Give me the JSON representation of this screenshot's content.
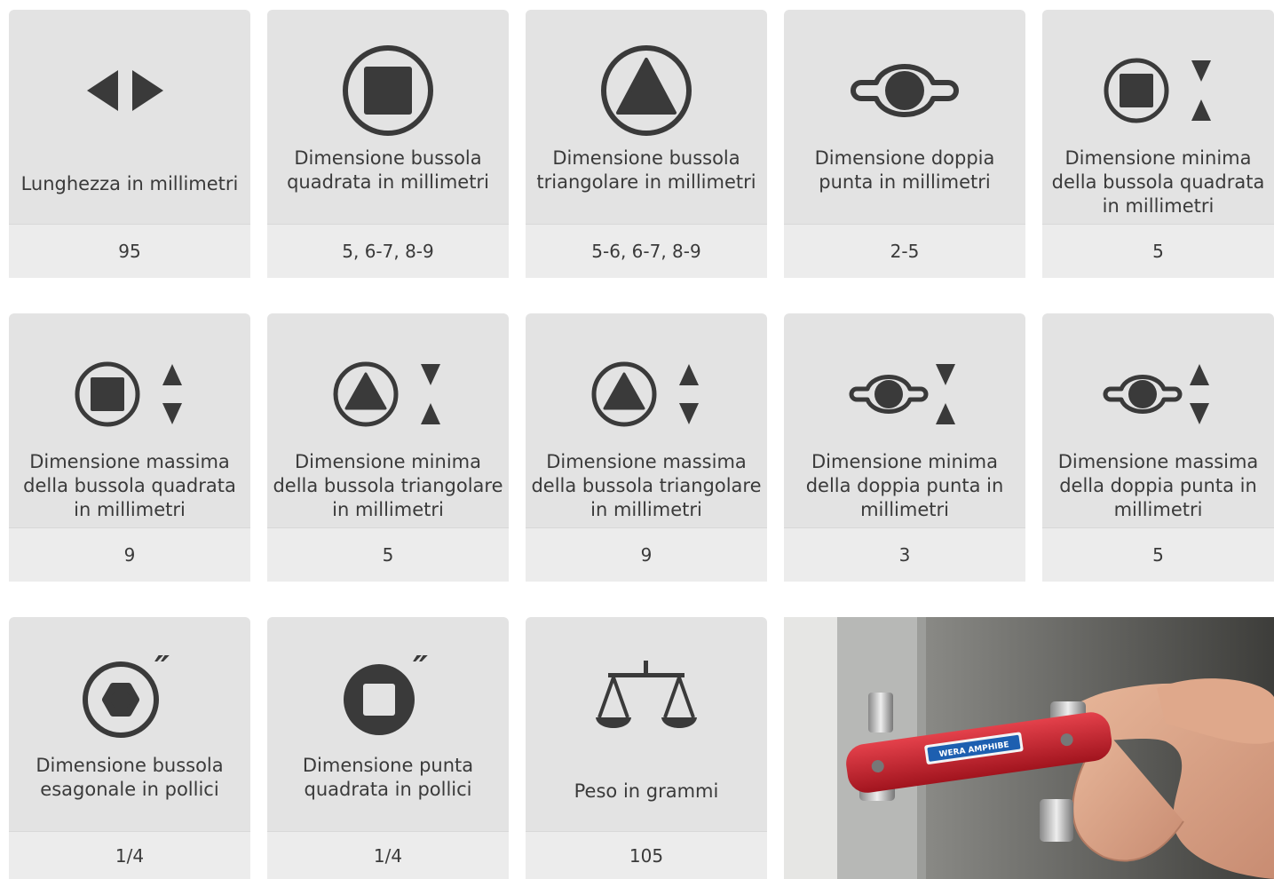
{
  "colors": {
    "card_bg": "#e3e3e3",
    "value_bg": "#ececec",
    "icon": "#3a3a3a",
    "brand_red": "#c8202c"
  },
  "cards": [
    {
      "icon": "arrows-left-right-icon",
      "label": "Lunghezza in millimetri",
      "value": "95"
    },
    {
      "icon": "square-socket-icon",
      "label": "Dimensione bussola\nquadrata in millimetri",
      "value": "5, 6-7, 8-9"
    },
    {
      "icon": "triangle-socket-icon",
      "label": "Dimensione bussola\ntriangolare in millimetri",
      "value": "5-6, 6-7, 8-9"
    },
    {
      "icon": "double-bit-icon",
      "label": "Dimensione doppia\npunta in millimetri",
      "value": "2-5"
    },
    {
      "icon": "square-socket-min-icon",
      "label": "Dimensione minima\ndella bussola quadrata\nin millimetri",
      "value": "5"
    },
    {
      "icon": "square-socket-max-icon",
      "label": "Dimensione massima\ndella bussola quadrata\nin millimetri",
      "value": "9"
    },
    {
      "icon": "triangle-socket-min-icon",
      "label": "Dimensione minima\ndella bussola triangolare\nin millimetri",
      "value": "5"
    },
    {
      "icon": "triangle-socket-max-icon",
      "label": "Dimensione massima\ndella bussola triangolare\nin millimetri",
      "value": "9"
    },
    {
      "icon": "double-bit-min-icon",
      "label": "Dimensione minima\ndella doppia punta in\nmillimetri",
      "value": "3"
    },
    {
      "icon": "double-bit-max-icon",
      "label": "Dimensione massima\ndella doppia punta in\nmillimetri",
      "value": "5"
    },
    {
      "icon": "hex-socket-inch-icon",
      "label": "Dimensione bussola\nesagonale in pollici",
      "value": "1/4"
    },
    {
      "icon": "square-bit-inch-icon",
      "label": "Dimensione punta\nquadrata in pollici",
      "value": "1/4"
    },
    {
      "icon": "scale-icon",
      "label": "Peso in grammi",
      "value": "105"
    }
  ],
  "photo": {
    "icon": "product-photo-hand-cabinet-key",
    "brand_text": "WERA AMPHIBE"
  }
}
